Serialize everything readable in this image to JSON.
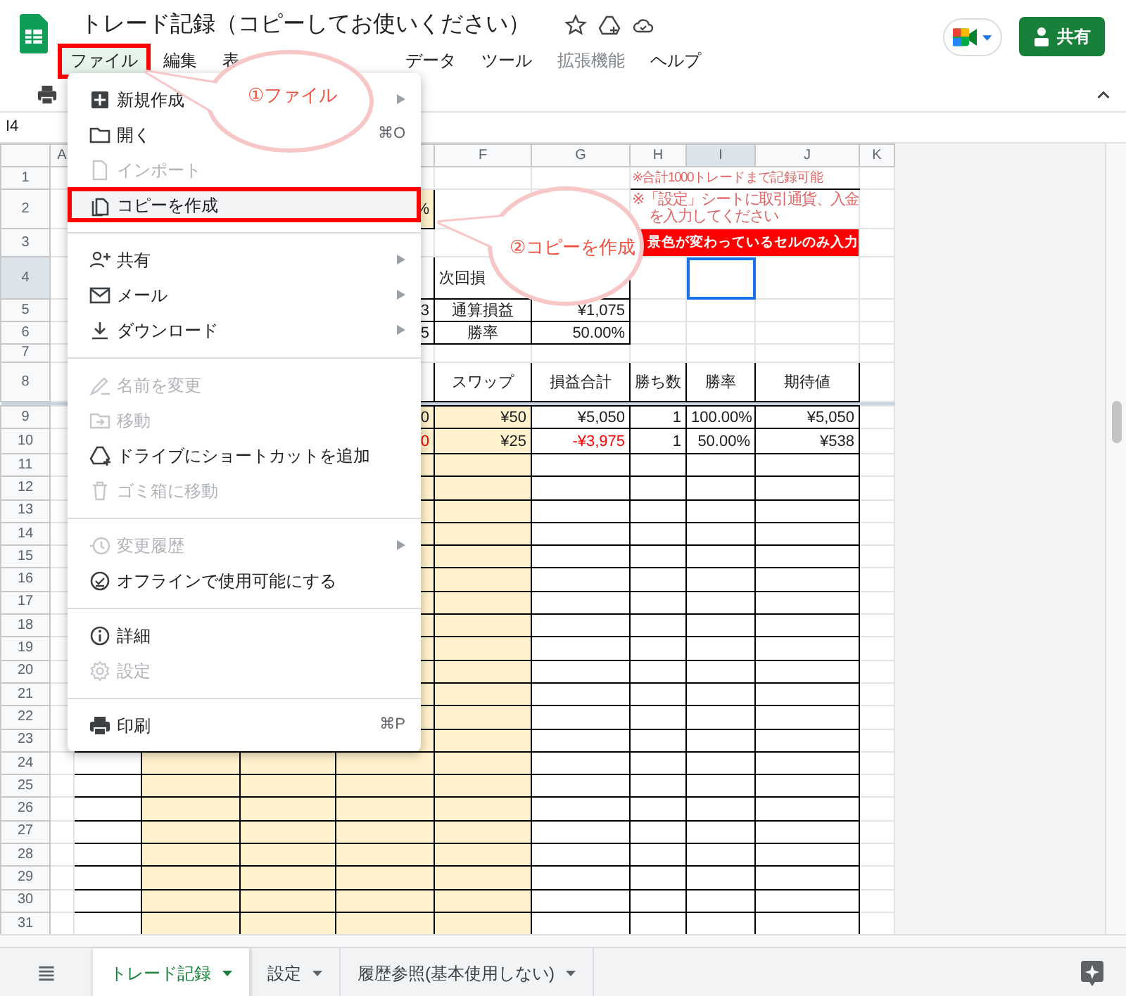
{
  "window": {
    "title": "トレード記録（コピーしてお使いください）",
    "share_button": "共有"
  },
  "menubar": [
    {
      "label": "ファイル",
      "selected": true,
      "annotated": true,
      "dimmed": false
    },
    {
      "label": "編集",
      "selected": false,
      "annotated": false,
      "dimmed": false
    },
    {
      "label": "表",
      "selected": false,
      "annotated": false,
      "dimmed": false
    },
    {
      "label": "データ",
      "selected": false,
      "annotated": false,
      "dimmed": false
    },
    {
      "label": "ツール",
      "selected": false,
      "annotated": false,
      "dimmed": false
    },
    {
      "label": "拡張機能",
      "selected": false,
      "annotated": false,
      "dimmed": true
    },
    {
      "label": "ヘルプ",
      "selected": false,
      "annotated": false,
      "dimmed": false
    }
  ],
  "name_box": "I4",
  "file_menu": [
    {
      "kind": "item",
      "label": "新規作成",
      "submenu": true,
      "disabled": false,
      "highlighted": false,
      "annotated": false
    },
    {
      "kind": "item",
      "label": "開く",
      "shortcut": "⌘O",
      "submenu": false,
      "disabled": false,
      "highlighted": false,
      "annotated": false
    },
    {
      "kind": "item",
      "label": "インポート",
      "submenu": false,
      "disabled": true,
      "highlighted": false,
      "annotated": false
    },
    {
      "kind": "item",
      "label": "コピーを作成",
      "submenu": false,
      "disabled": false,
      "highlighted": true,
      "annotated": true
    },
    {
      "kind": "divider"
    },
    {
      "kind": "item",
      "label": "共有",
      "submenu": true,
      "disabled": false,
      "highlighted": false,
      "annotated": false
    },
    {
      "kind": "item",
      "label": "メール",
      "submenu": true,
      "disabled": false,
      "highlighted": false,
      "annotated": false
    },
    {
      "kind": "item",
      "label": "ダウンロード",
      "submenu": true,
      "disabled": false,
      "highlighted": false,
      "annotated": false
    },
    {
      "kind": "divider"
    },
    {
      "kind": "item",
      "label": "名前を変更",
      "submenu": false,
      "disabled": true,
      "highlighted": false,
      "annotated": false
    },
    {
      "kind": "item",
      "label": "移動",
      "submenu": false,
      "disabled": true,
      "highlighted": false,
      "annotated": false
    },
    {
      "kind": "item",
      "label": "ドライブにショートカットを追加",
      "submenu": false,
      "disabled": false,
      "highlighted": false,
      "annotated": false
    },
    {
      "kind": "item",
      "label": "ゴミ箱に移動",
      "submenu": false,
      "disabled": true,
      "highlighted": false,
      "annotated": false
    },
    {
      "kind": "divider"
    },
    {
      "kind": "item",
      "label": "変更履歴",
      "submenu": true,
      "disabled": true,
      "highlighted": false,
      "annotated": false
    },
    {
      "kind": "item",
      "label": "オフラインで使用可能にする",
      "submenu": false,
      "disabled": false,
      "highlighted": false,
      "annotated": false
    },
    {
      "kind": "divider"
    },
    {
      "kind": "item",
      "label": "詳細",
      "submenu": false,
      "disabled": false,
      "highlighted": false,
      "annotated": false
    },
    {
      "kind": "item",
      "label": "設定",
      "submenu": false,
      "disabled": true,
      "highlighted": false,
      "annotated": false
    },
    {
      "kind": "divider"
    },
    {
      "kind": "item",
      "label": "印刷",
      "shortcut": "⌘P",
      "submenu": false,
      "disabled": false,
      "highlighted": false,
      "annotated": false
    }
  ],
  "callouts": [
    {
      "text": "①ファイル"
    },
    {
      "text": "②コピーを作成"
    }
  ],
  "sheet": {
    "columns": [
      {
        "letter": "A",
        "selected": false
      },
      {
        "letter": "F",
        "selected": false
      },
      {
        "letter": "G",
        "selected": false
      },
      {
        "letter": "H",
        "selected": false
      },
      {
        "letter": "I",
        "selected": true
      },
      {
        "letter": "J",
        "selected": false
      },
      {
        "letter": "K",
        "selected": false
      }
    ],
    "rows": [
      {
        "number": "1",
        "selected": false,
        "cells": [
          null,
          null,
          null,
          null,
          null,
          null,
          null,
          {
            "text": "※合計1000トレードまで記録可能",
            "color": "#e06666"
          },
          null,
          null,
          null
        ]
      },
      {
        "number": "2",
        "selected": false,
        "cells": [
          null,
          null,
          null,
          null,
          "%",
          null,
          null,
          {
            "lines": [
              "※「設定」シートに取引通貨、入金",
              "を入力してください"
            ],
            "color": "#e06666"
          },
          null,
          null,
          null
        ]
      },
      {
        "number": "3",
        "selected": false,
        "cells": [
          null,
          null,
          null,
          null,
          null,
          null,
          null,
          {
            "kind": "banner",
            "text": "景色が変わっているセルのみ入力",
            "color": "#ff0000"
          },
          null,
          null,
          null
        ]
      },
      {
        "number": "4",
        "selected": true,
        "cells": [
          null,
          null,
          null,
          null,
          null,
          "次回損",
          null,
          null,
          null,
          null,
          null
        ]
      },
      {
        "number": "5",
        "selected": false,
        "cells": [
          null,
          null,
          null,
          null,
          "3",
          "通算損益",
          "¥1,075",
          null,
          null,
          null,
          null
        ]
      },
      {
        "number": "6",
        "selected": false,
        "cells": [
          null,
          null,
          null,
          null,
          "5",
          "勝率",
          "50.00%",
          null,
          null,
          null,
          null
        ]
      },
      {
        "number": "7",
        "selected": false
      },
      {
        "number": "8",
        "selected": false,
        "cells": [
          null,
          null,
          null,
          null,
          null,
          "スワップ",
          "損益合計",
          "勝ち数",
          "勝率",
          "期待値",
          null
        ]
      },
      {
        "number": "9",
        "selected": false,
        "cells": [
          null,
          null,
          null,
          null,
          "0",
          "¥50",
          "¥5,050",
          "1",
          "100.00%",
          "¥5,050",
          null
        ]
      },
      {
        "number": "10",
        "selected": false,
        "cells": [
          null,
          null,
          null,
          null,
          {
            "text": "0",
            "color": "#ff0000"
          },
          "¥25",
          {
            "text": "-¥3,975",
            "color": "#ff0000"
          },
          "1",
          "50.00%",
          "¥538",
          null
        ]
      },
      {
        "number": "11",
        "selected": false
      },
      {
        "number": "12",
        "selected": false
      },
      {
        "number": "13",
        "selected": false
      },
      {
        "number": "14",
        "selected": false
      },
      {
        "number": "15",
        "selected": false
      },
      {
        "number": "16",
        "selected": false
      },
      {
        "number": "17",
        "selected": false
      },
      {
        "number": "18",
        "selected": false
      },
      {
        "number": "19",
        "selected": false
      },
      {
        "number": "20",
        "selected": false
      },
      {
        "number": "21",
        "selected": false
      },
      {
        "number": "22",
        "selected": false
      },
      {
        "number": "23",
        "selected": false
      },
      {
        "number": "24",
        "selected": false
      },
      {
        "number": "25",
        "selected": false
      },
      {
        "number": "26",
        "selected": false
      },
      {
        "number": "27",
        "selected": false
      },
      {
        "number": "28",
        "selected": false
      },
      {
        "number": "29",
        "selected": false
      },
      {
        "number": "30",
        "selected": false
      },
      {
        "number": "31",
        "selected": false
      }
    ]
  },
  "sheet_tabs": [
    {
      "label": "トレード記録",
      "selected": true
    },
    {
      "label": "設定",
      "selected": false
    },
    {
      "label": "履歴参照(基本使用しない)",
      "selected": false
    }
  ]
}
